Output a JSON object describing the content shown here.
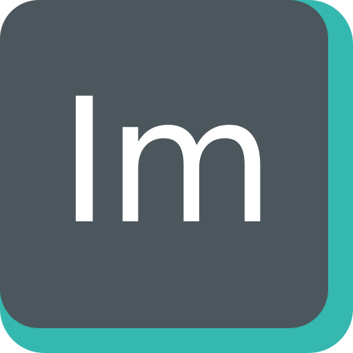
{
  "icon": {
    "monogram": "Im",
    "colors": {
      "face": "#4b575d",
      "accent": "#35b8b0",
      "text": "#ffffff"
    }
  }
}
